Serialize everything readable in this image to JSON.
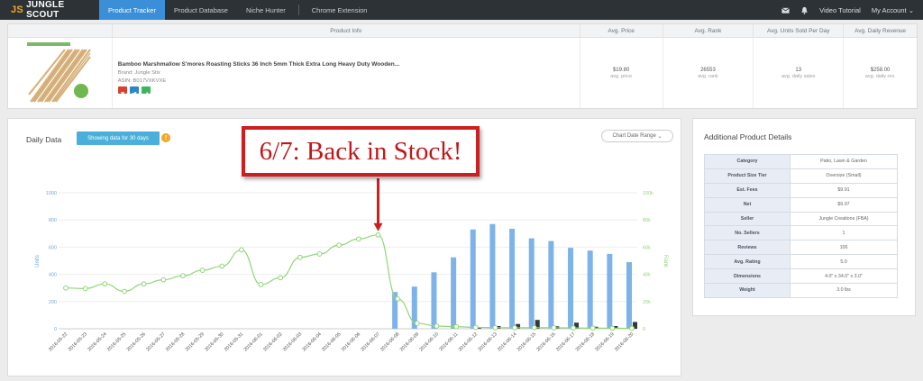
{
  "nav": {
    "logo_js": "JS",
    "logo_text": "JUNGLE SCOUT",
    "tabs": [
      {
        "label": "Product Tracker"
      },
      {
        "label": "Product Database"
      },
      {
        "label": "Niche Hunter"
      },
      {
        "label": "Chrome Extension"
      }
    ],
    "video_tutorial": "Video Tutorial",
    "my_account": "My Account"
  },
  "product_table": {
    "headers": [
      "Product Info",
      "Avg. Price",
      "Avg. Rank",
      "Avg. Units Sold Per Day",
      "Avg. Daily Revenue"
    ],
    "title": "Bamboo Marshmallow S'mores Roasting Sticks 36 Inch 5mm Thick Extra Long Heavy Duty Wooden...",
    "brand": "Brand: Jungle Stix",
    "asin": "ASIN: B017VXKVXE",
    "price": "$19.80",
    "price_sub": "avg. price",
    "rank": "26553",
    "rank_sub": "avg. rank",
    "units": "13",
    "units_sub": "avg. daily sales",
    "revenue": "$258.00",
    "revenue_sub": "avg. daily rev."
  },
  "daily_data": {
    "title": "Daily Data",
    "range_pill": "Showing data for 30 days",
    "date_range_button": "Chart Date Range",
    "callout": "6/7: Back in Stock!"
  },
  "details": {
    "title": "Additional Product Details",
    "rows": [
      {
        "key": "Category",
        "value": "Patio, Lawn & Garden"
      },
      {
        "key": "Product Size Tier",
        "value": "Oversize (Small)"
      },
      {
        "key": "Est. Fees",
        "value": "$9.91"
      },
      {
        "key": "Net",
        "value": "$9.97"
      },
      {
        "key": "Seller",
        "value": "Jungle Creations (FBA)"
      },
      {
        "key": "No. Sellers",
        "value": "1"
      },
      {
        "key": "Reviews",
        "value": "106"
      },
      {
        "key": "Avg. Rating",
        "value": "5.0"
      },
      {
        "key": "Dimensions",
        "value": "4.0\" x 34.0\" x 3.0\""
      },
      {
        "key": "Weight",
        "value": "3.0 lbs"
      }
    ]
  },
  "chart_data": {
    "type": "bar",
    "categories": [
      "2016-05-22",
      "2016-05-23",
      "2016-05-24",
      "2016-05-25",
      "2016-05-26",
      "2016-05-27",
      "2016-05-28",
      "2016-05-29",
      "2016-05-30",
      "2016-05-31",
      "2016-06-01",
      "2016-06-02",
      "2016-06-03",
      "2016-06-04",
      "2016-06-05",
      "2016-06-06",
      "2016-06-07",
      "2016-06-08",
      "2016-06-09",
      "2016-06-10",
      "2016-06-11",
      "2016-06-12",
      "2016-06-13",
      "2016-06-14",
      "2016-06-15",
      "2016-06-16",
      "2016-06-17",
      "2016-06-18",
      "2016-06-19",
      "2016-06-20"
    ],
    "ylabel": "Units",
    "y2label": "Rank",
    "ylim": [
      0,
      1000
    ],
    "yticks": [
      "0",
      "200",
      "400",
      "600",
      "800",
      "1000"
    ],
    "y2lim": [
      0,
      100000
    ],
    "y2ticks": [
      "0",
      "20k",
      "40k",
      "60k",
      "80k",
      "100k"
    ],
    "series": [
      {
        "kind": "bar",
        "color": "#7db3e8",
        "values": [
          0,
          0,
          0,
          0,
          0,
          0,
          0,
          0,
          0,
          0,
          0,
          0,
          0,
          0,
          0,
          0,
          0,
          270,
          310,
          415,
          525,
          730,
          770,
          735,
          665,
          645,
          595,
          575,
          550,
          490
        ]
      },
      {
        "kind": "bar",
        "color": "#2f3b37",
        "values": [
          0,
          0,
          0,
          0,
          0,
          0,
          0,
          0,
          0,
          0,
          0,
          0,
          0,
          0,
          0,
          0,
          0,
          0,
          0,
          0,
          0,
          10,
          20,
          35,
          65,
          18,
          45,
          15,
          20,
          50
        ]
      },
      {
        "kind": "line",
        "color": "#8fd676",
        "values": [
          30000,
          29500,
          33000,
          27500,
          33000,
          36000,
          39000,
          43000,
          46000,
          58000,
          32500,
          37500,
          52500,
          55000,
          61500,
          66000,
          69000,
          22000,
          4000,
          2000,
          1500,
          1000,
          800,
          700,
          800,
          700,
          600,
          500,
          400,
          350
        ]
      }
    ]
  }
}
